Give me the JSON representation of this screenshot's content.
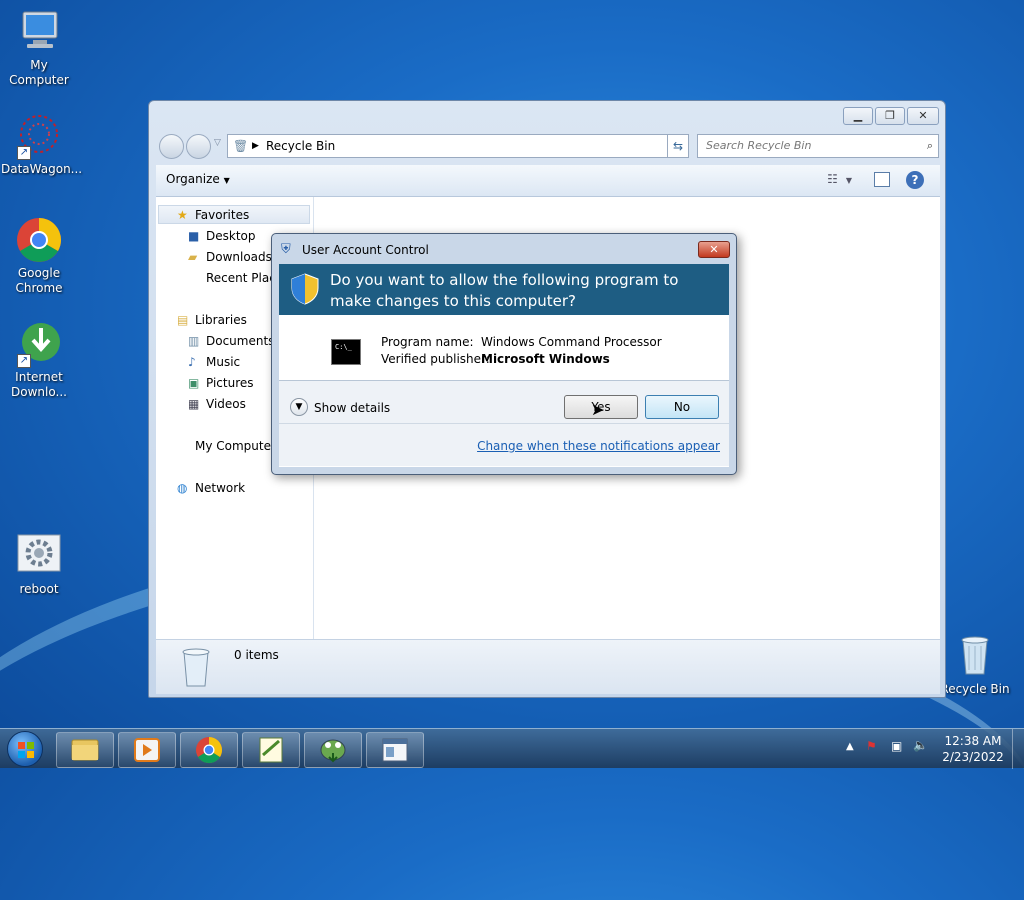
{
  "desktop": {
    "icons": [
      {
        "label": "My Computer"
      },
      {
        "label": "DataWagon..."
      },
      {
        "label": "Google Chrome"
      },
      {
        "label": "Internet Downlo..."
      },
      {
        "label": "reboot"
      },
      {
        "label": "Recycle Bin"
      }
    ]
  },
  "explorer": {
    "address": "Recycle Bin",
    "search_placeholder": "Search Recycle Bin",
    "organize": "Organize",
    "nav": {
      "favorites": "Favorites",
      "desktop": "Desktop",
      "downloads": "Downloads",
      "recent": "Recent Places",
      "libraries": "Libraries",
      "documents": "Documents",
      "music": "Music",
      "pictures": "Pictures",
      "videos": "Videos",
      "computer": "My Computer",
      "network": "Network"
    },
    "status_items": "0 items"
  },
  "uac": {
    "title": "User Account Control",
    "question": "Do you want to allow the following program to make changes to this computer?",
    "program_label": "Program name:",
    "program_value": "Windows Command Processor",
    "publisher_label": "Verified publisher:",
    "publisher_value": "Microsoft Windows",
    "show_details": "Show details",
    "yes": "Yes",
    "no": "No",
    "change_link": "Change when these notifications appear"
  },
  "taskbar": {
    "time": "12:38 AM",
    "date": "2/23/2022"
  },
  "colors": {
    "uac_banner": "#1e5d83",
    "link": "#1a5fb4"
  }
}
